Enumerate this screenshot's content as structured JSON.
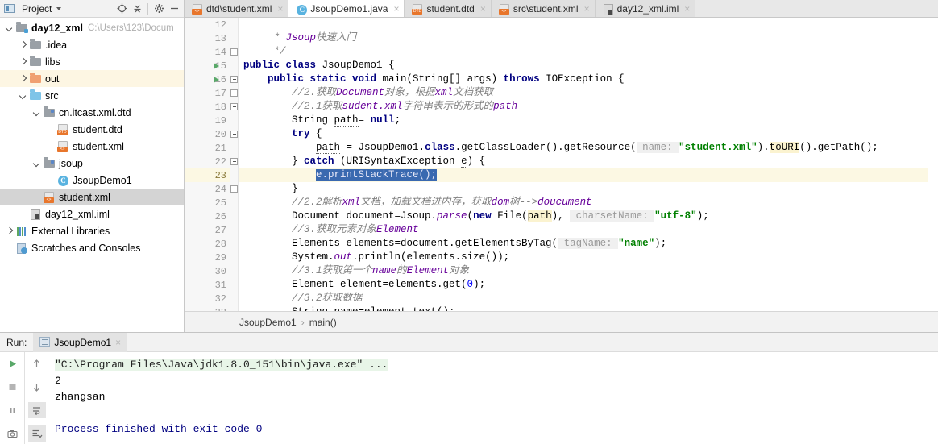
{
  "project_panel": {
    "title": "Project",
    "icons": [
      "locate-icon",
      "collapse-all-icon",
      "gear-icon",
      "minimize-icon"
    ],
    "tree": [
      {
        "label": "day12_xml",
        "secondary": "C:\\Users\\123\\Docum",
        "icon": "folder-module",
        "arrow": "down",
        "indent": 0,
        "bold": true,
        "state": "normal"
      },
      {
        "label": ".idea",
        "icon": "folder-grey",
        "arrow": "right",
        "indent": 1,
        "bold": false,
        "state": "normal"
      },
      {
        "label": "libs",
        "icon": "folder-grey",
        "arrow": "right",
        "indent": 1,
        "bold": false,
        "state": "normal"
      },
      {
        "label": "out",
        "icon": "folder-orange",
        "arrow": "right",
        "indent": 1,
        "bold": false,
        "state": "highlight"
      },
      {
        "label": "src",
        "icon": "folder-blue",
        "arrow": "down",
        "indent": 1,
        "bold": false,
        "state": "normal"
      },
      {
        "label": "cn.itcast.xml.dtd",
        "icon": "folder-package",
        "arrow": "down",
        "indent": 2,
        "bold": false,
        "state": "normal"
      },
      {
        "label": "student.dtd",
        "icon": "file-dtd",
        "arrow": "none",
        "indent": 3,
        "bold": false,
        "state": "normal"
      },
      {
        "label": "student.xml",
        "icon": "file-xml",
        "arrow": "none",
        "indent": 3,
        "bold": false,
        "state": "normal"
      },
      {
        "label": "jsoup",
        "icon": "folder-package",
        "arrow": "down",
        "indent": 2,
        "bold": false,
        "state": "normal"
      },
      {
        "label": "JsoupDemo1",
        "icon": "file-class",
        "arrow": "none",
        "indent": 3,
        "bold": false,
        "state": "normal"
      },
      {
        "label": "student.xml",
        "icon": "file-xml",
        "arrow": "none",
        "indent": 2,
        "bold": false,
        "state": "selected"
      },
      {
        "label": "day12_xml.iml",
        "icon": "file-iml",
        "arrow": "none",
        "indent": 1,
        "bold": false,
        "state": "normal"
      },
      {
        "label": "External Libraries",
        "icon": "external-libraries",
        "arrow": "right",
        "indent": 0,
        "bold": false,
        "state": "normal"
      },
      {
        "label": "Scratches and Consoles",
        "icon": "scratches",
        "arrow": "none",
        "indent": 0,
        "bold": false,
        "state": "normal"
      }
    ]
  },
  "editor": {
    "tabs": [
      {
        "label": "dtd\\student.xml",
        "icon": "file-xml",
        "active": false
      },
      {
        "label": "JsoupDemo1.java",
        "icon": "file-class",
        "active": true
      },
      {
        "label": "student.dtd",
        "icon": "file-dtd",
        "active": false
      },
      {
        "label": "src\\student.xml",
        "icon": "file-xml",
        "active": false
      },
      {
        "label": "day12_xml.iml",
        "icon": "file-iml",
        "active": false
      }
    ],
    "first_line_number": 12,
    "current_line": 23,
    "lines": [
      {
        "n": 12,
        "segments": []
      },
      {
        "n": 13,
        "segments": [
          {
            "t": "     * ",
            "c": "cm"
          },
          {
            "t": "Jsoup",
            "c": "nm"
          },
          {
            "t": "快速入门",
            "c": "cm"
          }
        ]
      },
      {
        "n": 14,
        "segments": [
          {
            "t": "     */",
            "c": "cm"
          }
        ]
      },
      {
        "n": 15,
        "segments": [
          {
            "t": "public class ",
            "c": "kw"
          },
          {
            "t": "JsoupDemo1 {",
            "c": "plain"
          }
        ]
      },
      {
        "n": 16,
        "segments": [
          {
            "t": "    ",
            "c": "plain"
          },
          {
            "t": "public static void ",
            "c": "kw"
          },
          {
            "t": "main(String[] args) ",
            "c": "plain"
          },
          {
            "t": "throws ",
            "c": "kw"
          },
          {
            "t": "IOException {",
            "c": "plain"
          }
        ]
      },
      {
        "n": 17,
        "segments": [
          {
            "t": "        //2.获取",
            "c": "cm"
          },
          {
            "t": "Document",
            "c": "nm"
          },
          {
            "t": "对象，根据",
            "c": "cm"
          },
          {
            "t": "xml",
            "c": "nm"
          },
          {
            "t": "文档获取",
            "c": "cm"
          }
        ]
      },
      {
        "n": 18,
        "segments": [
          {
            "t": "        //2.1获取",
            "c": "cm"
          },
          {
            "t": "sudent.xml",
            "c": "nm"
          },
          {
            "t": "字符串表示的形式的",
            "c": "cm"
          },
          {
            "t": "path",
            "c": "nm"
          }
        ]
      },
      {
        "n": 19,
        "segments": [
          {
            "t": "        String ",
            "c": "plain"
          },
          {
            "t": "path",
            "c": "ul"
          },
          {
            "t": "= ",
            "c": "plain"
          },
          {
            "t": "null",
            "c": "kw"
          },
          {
            "t": ";",
            "c": "plain"
          }
        ]
      },
      {
        "n": 20,
        "segments": [
          {
            "t": "        ",
            "c": "plain"
          },
          {
            "t": "try",
            "c": "kw"
          },
          {
            "t": " {",
            "c": "plain"
          }
        ]
      },
      {
        "n": 21,
        "segments": [
          {
            "t": "            ",
            "c": "plain"
          },
          {
            "t": "path",
            "c": "ul"
          },
          {
            "t": " = JsoupDemo1.",
            "c": "plain"
          },
          {
            "t": "class",
            "c": "kw"
          },
          {
            "t": ".getClassLoader().getResource(",
            "c": "plain"
          },
          {
            "t": " name: ",
            "c": "hint"
          },
          {
            "t": "\"student.xml\"",
            "c": "st"
          },
          {
            "t": ").",
            "c": "plain"
          },
          {
            "t": "toURI",
            "c": "wh"
          },
          {
            "t": "().getPath();",
            "c": "plain"
          }
        ]
      },
      {
        "n": 22,
        "segments": [
          {
            "t": "        } ",
            "c": "plain"
          },
          {
            "t": "catch",
            "c": "kw"
          },
          {
            "t": " (URISyntaxException ",
            "c": "plain"
          },
          {
            "t": "e",
            "c": "ul"
          },
          {
            "t": ") {",
            "c": "plain"
          }
        ]
      },
      {
        "n": 23,
        "segments": [
          {
            "t": "            ",
            "c": "plain"
          },
          {
            "t": "e.printStackTrace();",
            "c": "selhl"
          }
        ]
      },
      {
        "n": 24,
        "segments": [
          {
            "t": "        }",
            "c": "plain"
          }
        ]
      },
      {
        "n": 25,
        "segments": [
          {
            "t": "        //2.2解析",
            "c": "cm"
          },
          {
            "t": "xml",
            "c": "nm"
          },
          {
            "t": "文档，加载文档进内存，获取",
            "c": "cm"
          },
          {
            "t": "dom",
            "c": "nm"
          },
          {
            "t": "树-->",
            "c": "cm"
          },
          {
            "t": "doucument",
            "c": "nm"
          }
        ]
      },
      {
        "n": 26,
        "segments": [
          {
            "t": "        Document document=Jsoup.",
            "c": "plain"
          },
          {
            "t": "parse",
            "c": "nm"
          },
          {
            "t": "(",
            "c": "plain"
          },
          {
            "t": "new ",
            "c": "kw"
          },
          {
            "t": "File(",
            "c": "plain"
          },
          {
            "t": "path",
            "c": "wh"
          },
          {
            "t": "), ",
            "c": "plain"
          },
          {
            "t": " charsetName: ",
            "c": "hint"
          },
          {
            "t": "\"utf-8\"",
            "c": "st"
          },
          {
            "t": ");",
            "c": "plain"
          }
        ]
      },
      {
        "n": 27,
        "segments": [
          {
            "t": "        //3.获取元素对象",
            "c": "cm"
          },
          {
            "t": "Element",
            "c": "nm"
          }
        ]
      },
      {
        "n": 28,
        "segments": [
          {
            "t": "        Elements elements=document.getElementsByTag(",
            "c": "plain"
          },
          {
            "t": " tagName: ",
            "c": "hint"
          },
          {
            "t": "\"name\"",
            "c": "st"
          },
          {
            "t": ");",
            "c": "plain"
          }
        ]
      },
      {
        "n": 29,
        "segments": [
          {
            "t": "        System.",
            "c": "plain"
          },
          {
            "t": "out",
            "c": "nm"
          },
          {
            "t": ".println(elements.size());",
            "c": "plain"
          }
        ]
      },
      {
        "n": 30,
        "segments": [
          {
            "t": "        //3.1获取第一个",
            "c": "cm"
          },
          {
            "t": "name",
            "c": "nm"
          },
          {
            "t": "的",
            "c": "cm"
          },
          {
            "t": "Element",
            "c": "nm"
          },
          {
            "t": "对象",
            "c": "cm"
          }
        ]
      },
      {
        "n": 31,
        "segments": [
          {
            "t": "        Element element=elements.get(",
            "c": "plain"
          },
          {
            "t": "0",
            "c": "num"
          },
          {
            "t": ");",
            "c": "plain"
          }
        ]
      },
      {
        "n": 32,
        "segments": [
          {
            "t": "        //3.2获取数据",
            "c": "cm"
          }
        ]
      },
      {
        "n": 33,
        "segments": [
          {
            "t": "        String name=element.text();",
            "c": "plain"
          }
        ]
      }
    ],
    "run_gutter_lines": [
      15,
      16
    ],
    "breadcrumb": {
      "class": "JsoupDemo1",
      "separator": "›",
      "method": "main()"
    }
  },
  "run_panel": {
    "label": "Run:",
    "tab_label": "JsoupDemo1",
    "close_label": "×",
    "left_tools": [
      "rerun-icon",
      "stop-icon",
      "pause-icon",
      "camera-icon"
    ],
    "right_tools": [
      "up-arrow-icon",
      "down-arrow-icon",
      "soft-wrap-icon",
      "scroll-to-end-icon"
    ],
    "console": {
      "command": "\"C:\\Program Files\\Java\\jdk1.8.0_151\\bin\\java.exe\" ...",
      "output": [
        "2",
        "zhangsan",
        ""
      ],
      "finished": "Process finished with exit code 0"
    }
  },
  "colors": {
    "selection": "#3a69b0",
    "current_line": "#fcf8e3",
    "keyword": "#000080",
    "comment": "#808080",
    "string": "#008000",
    "run_green": "#59a869",
    "tree_selected": "#d4d4d4"
  }
}
